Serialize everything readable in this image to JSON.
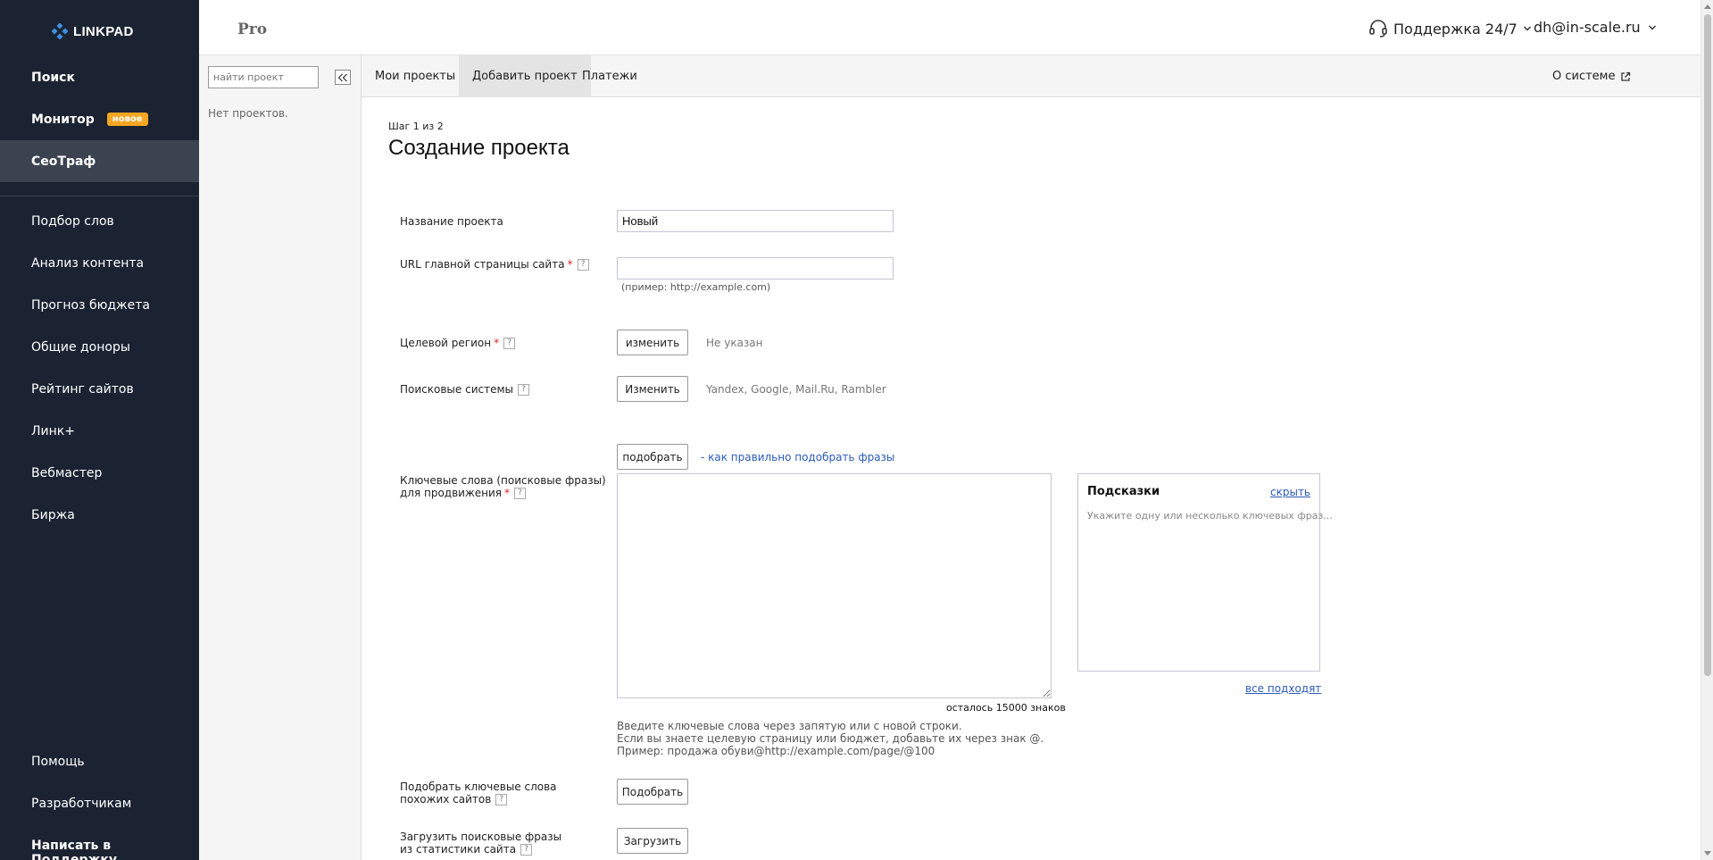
{
  "brand": {
    "logo_text": "LINKPAD",
    "accent": "#f5a623",
    "sidebar_bg": "#1b2332",
    "link_color": "#2b5bb8"
  },
  "sidebar": {
    "top_items": [
      {
        "label": "Поиск"
      },
      {
        "label": "Монитор",
        "badge": "новое"
      },
      {
        "label": "СеоТраф"
      }
    ],
    "tools": [
      {
        "label": "Подбор слов"
      },
      {
        "label": "Анализ контента"
      },
      {
        "label": "Прогноз бюджета"
      },
      {
        "label": "Общие доноры"
      },
      {
        "label": "Рейтинг сайтов"
      },
      {
        "label": "Линк+"
      },
      {
        "label": "Вебмастер"
      },
      {
        "label": "Биржа"
      }
    ],
    "bottom": [
      {
        "label": "Помощь"
      },
      {
        "label": "Разработчикам"
      },
      {
        "label": "Написать в Поддержку"
      }
    ]
  },
  "header": {
    "plan": "Pro",
    "support": "Поддержка 24/7",
    "user": "dh@in-scale.ru"
  },
  "projects": {
    "search_placeholder": "найти проект",
    "empty": "Нет проектов."
  },
  "tabs": [
    {
      "label": "Мои проекты"
    },
    {
      "label": "Добавить проект"
    },
    {
      "label": "Платежи"
    }
  ],
  "about": "О системе",
  "form": {
    "step": "Шаг 1 из 2",
    "title": "Создание проекта",
    "name_label": "Название проекта",
    "name_value": "Новый",
    "url_label": "URL главной страницы сайта",
    "url_value": "",
    "url_example": "(пример: http://example.com)",
    "region_label": "Целевой регион",
    "region_button": "изменить",
    "region_value": "Не указан",
    "engines_label": "Поисковые системы",
    "engines_button": "Изменить",
    "engines_value": "Yandex, Google, Mail.Ru, Rambler",
    "pick_button": "подобрать",
    "pick_link": "- как правильно подобрать фразы",
    "keywords_label_line1": "Ключевые слова (поисковые фразы)",
    "keywords_label_line2": "для продвижения",
    "keywords_value": "",
    "chars_left": "осталось 15000 знаков",
    "keywords_help": [
      "Введите ключевые слова через запятую или с новой строки.",
      "Если вы знаете целевую страницу или бюджет, добавьте их через знак @.",
      "Пример: продажа обуви@http://example.com/page/@100"
    ],
    "similar_label_line1": "Подобрать ключевые слова",
    "similar_label_line2": "похожих сайтов",
    "similar_button": "Подобрать",
    "stats_label_line1": "Загрузить поисковые фразы",
    "stats_label_line2": "из статистики сайта",
    "stats_button": "Загрузить",
    "help_mark": "?",
    "required_mark": "*"
  },
  "tips": {
    "title": "Подсказки",
    "hide": "скрыть",
    "text": "Укажите одну или несколько ключевых фраз...",
    "all_fit": "все подходят"
  }
}
